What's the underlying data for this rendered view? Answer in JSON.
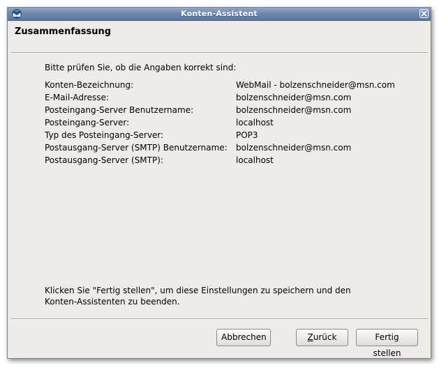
{
  "window": {
    "title": "Konten-Assistent"
  },
  "page": {
    "heading": "Zusammenfassung",
    "intro": "Bitte prüfen Sie, ob die Angaben korrekt sind:",
    "summary": [
      {
        "label": "Konten-Bezeichnung:",
        "value": "WebMail - bolzenschneider@msn.com"
      },
      {
        "label": "E-Mail-Adresse:",
        "value": "bolzenschneider@msn.com"
      },
      {
        "label": "Posteingang-Server Benutzername:",
        "value": "bolzenschneider@msn.com"
      },
      {
        "label": "Posteingang-Server:",
        "value": "localhost"
      },
      {
        "label": "Typ des Posteingang-Server:",
        "value": "POP3"
      },
      {
        "label": "Postausgang-Server (SMTP) Benutzername:",
        "value": "bolzenschneider@msn.com"
      },
      {
        "label": "Postausgang-Server (SMTP):",
        "value": "localhost"
      }
    ],
    "footer_line1": "Klicken Sie \"Fertig stellen\", um diese Einstellungen zu speichern und den",
    "footer_line2": "Konten-Assistenten zu beenden."
  },
  "buttons": {
    "cancel": "Abbrechen",
    "back_mnemonic": "Z",
    "back_rest": "urück",
    "finish": "Fertig stellen"
  },
  "icons": {
    "app": "thunderbird-icon",
    "close": "close-icon"
  }
}
